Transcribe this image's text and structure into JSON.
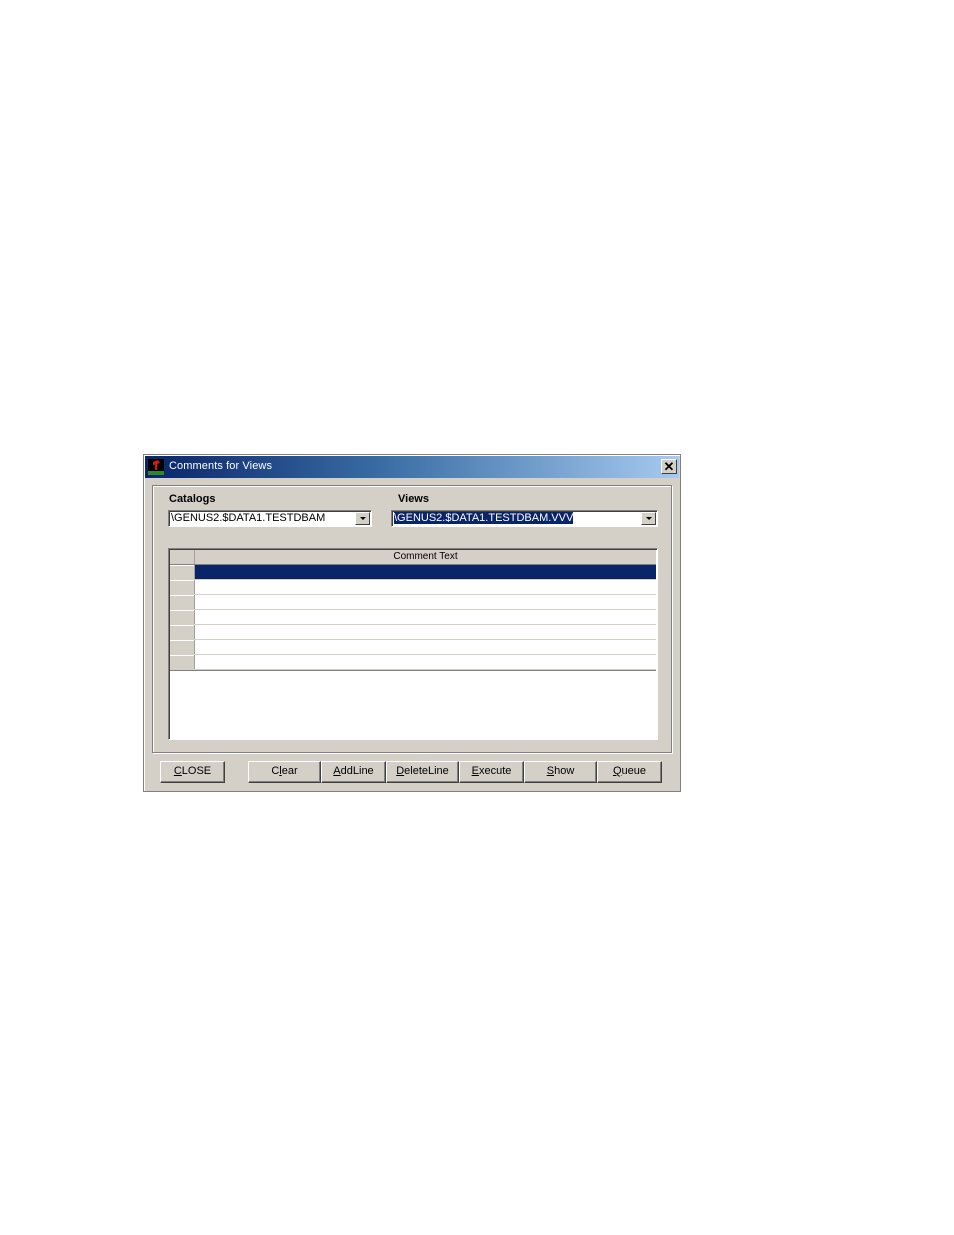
{
  "window": {
    "title": "Comments for Views",
    "app_icon": "unifaw-flag-icon",
    "close_icon": "close-icon",
    "close_glyph": "✕"
  },
  "catalogs": {
    "label": "Catalogs",
    "value": "\\GENUS2.$DATA1.TESTDBAM"
  },
  "views": {
    "label": "Views",
    "value": "\\GENUS2.$DATA1.TESTDBAM.VVV",
    "selected": true
  },
  "grid": {
    "columns": [
      "Comment Text"
    ],
    "rows": [
      {
        "text": "",
        "selected": true
      },
      {
        "text": "",
        "selected": false
      },
      {
        "text": "",
        "selected": false
      },
      {
        "text": "",
        "selected": false
      },
      {
        "text": "",
        "selected": false
      },
      {
        "text": "",
        "selected": false
      },
      {
        "text": "",
        "selected": false
      }
    ]
  },
  "buttons": {
    "close": {
      "mnemonic": "C",
      "rest": "LOSE"
    },
    "clear": {
      "pre": "C",
      "mnemonic": "l",
      "rest": "ear"
    },
    "addline": {
      "mnemonic": "A",
      "rest": "ddLine"
    },
    "deleteline": {
      "mnemonic": "D",
      "rest": "eleteLine"
    },
    "execute": {
      "mnemonic": "E",
      "rest": "xecute"
    },
    "show": {
      "mnemonic": "S",
      "rest": "how"
    },
    "queue": {
      "mnemonic": "Q",
      "rest": "ueue"
    }
  },
  "colors": {
    "titlebar_start": "#0a246a",
    "titlebar_end": "#a6caf0",
    "selection": "#0a246a",
    "face": "#d4d0c8"
  }
}
